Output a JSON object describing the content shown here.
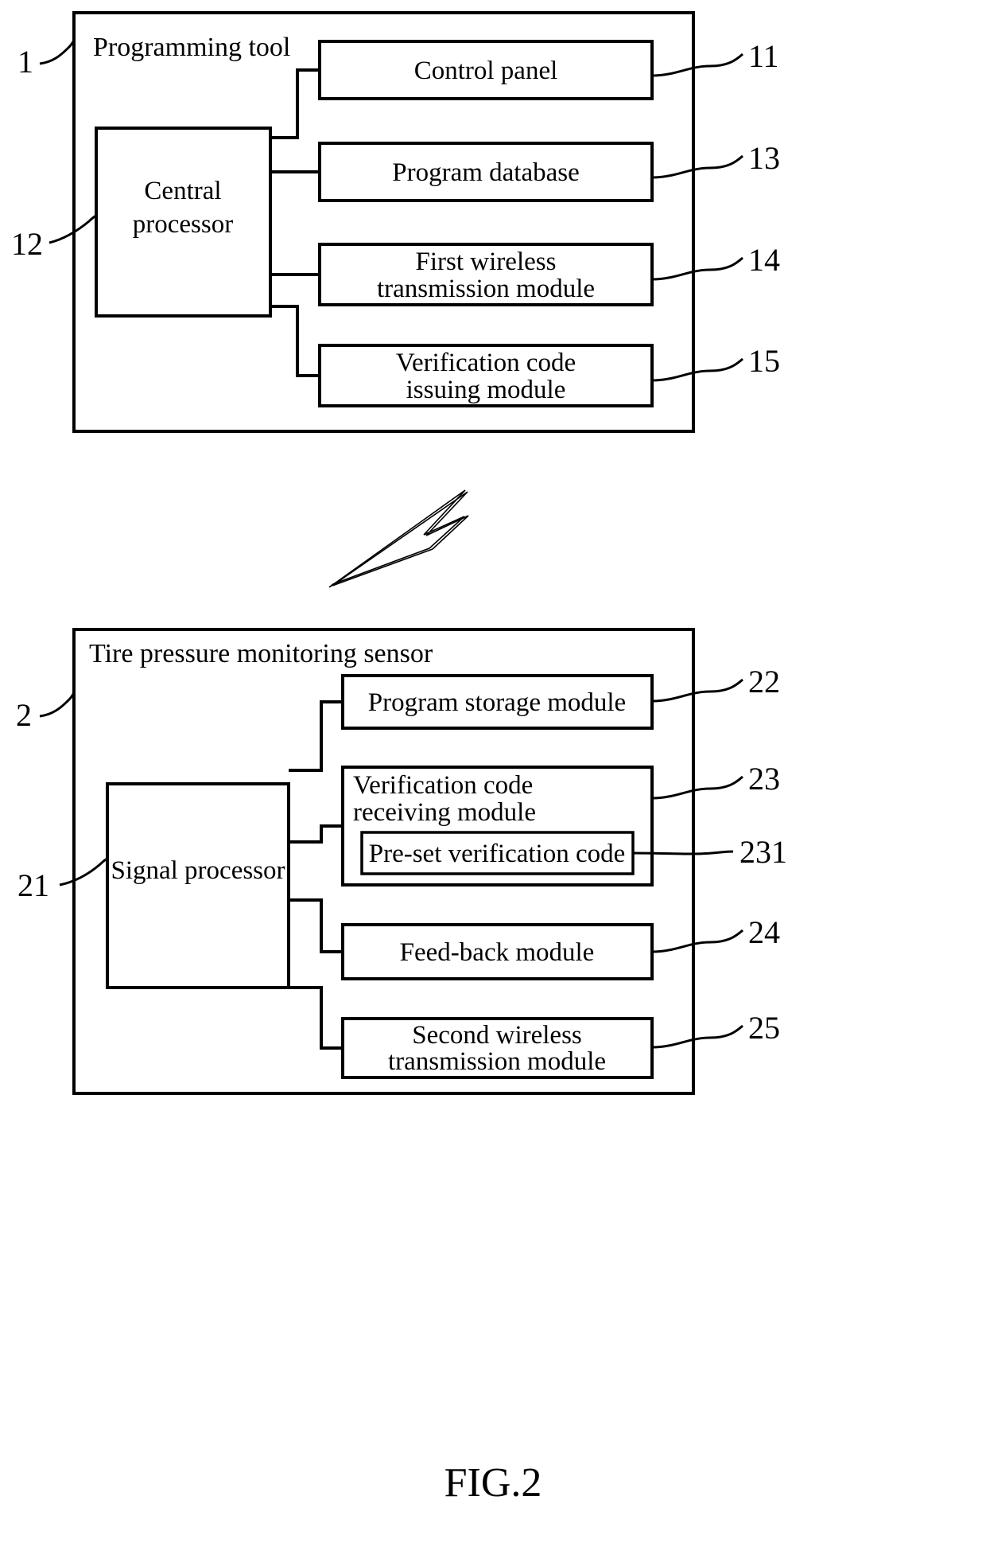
{
  "figure": {
    "caption": "FIG.2",
    "bolt_icon": "lightning-bolt-wireless-link"
  },
  "diagram_top": {
    "container_label": "Programming tool",
    "container_ref": "1",
    "processor": {
      "label_line1": "Central",
      "label_line2": "processor",
      "ref": "12"
    },
    "modules": [
      {
        "label_line1": "Control panel",
        "label_line2": "",
        "ref": "11"
      },
      {
        "label_line1": "Program database",
        "label_line2": "",
        "ref": "13"
      },
      {
        "label_line1": "First wireless",
        "label_line2": "transmission module",
        "ref": "14"
      },
      {
        "label_line1": "Verification code",
        "label_line2": "issuing module",
        "ref": "15"
      }
    ]
  },
  "diagram_bottom": {
    "container_label": "Tire pressure monitoring sensor",
    "container_ref": "2",
    "processor": {
      "label_line1": "Signal processor",
      "label_line2": "",
      "ref": "21"
    },
    "modules": [
      {
        "label_line1": "Program storage module",
        "label_line2": "",
        "ref": "22"
      },
      {
        "label_line1": "Verification code",
        "label_line2": "receiving module",
        "ref": "23"
      },
      {
        "label_line1": "Feed-back module",
        "label_line2": "",
        "ref": "24"
      },
      {
        "label_line1": "Second wireless",
        "label_line2": "transmission module",
        "ref": "25"
      }
    ],
    "nested": {
      "label": "Pre-set verification code",
      "ref": "231"
    }
  }
}
